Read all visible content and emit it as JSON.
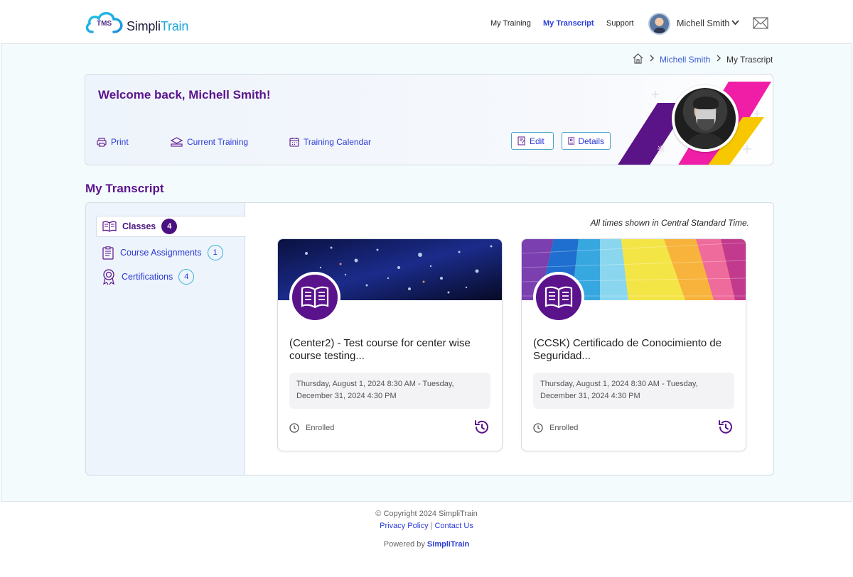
{
  "app": {
    "logo_badge": "TMS",
    "logo_name_part1": "Simpli",
    "logo_name_part2": "Train"
  },
  "nav": {
    "my_training": "My Training",
    "my_transcript": "My Transcript",
    "support": "Support",
    "user_name": "Michell Smith"
  },
  "breadcrumb": {
    "user": "Michell Smith",
    "current": "My Trascript"
  },
  "banner": {
    "welcome": "Welcome back, Michell Smith!",
    "print": "Print",
    "current_training": "Current Training",
    "training_calendar": "Training Calendar",
    "edit": "Edit",
    "details": "Details"
  },
  "section_title": "My Transcript",
  "sidebar": {
    "items": [
      {
        "label": "Classes",
        "count": "4",
        "active": true
      },
      {
        "label": "Course Assignments",
        "count": "1",
        "active": false
      },
      {
        "label": "Certifications",
        "count": "4",
        "active": false
      }
    ]
  },
  "timezone_note": "All times shown in Central Standard Time.",
  "cards": [
    {
      "title": "(Center2) - Test course for center wise course testing...",
      "dates": "Thursday, August 1, 2024 8:30 AM - Tuesday, December 31, 2024 4:30 PM",
      "status": "Enrolled"
    },
    {
      "title": "(CCSK) Certificado de Conocimiento de Seguridad...",
      "dates": "Thursday, August 1, 2024 8:30 AM - Tuesday, December 31, 2024 4:30 PM",
      "status": "Enrolled"
    }
  ],
  "footer": {
    "copyright": "© Copyright 2024  SimpliTrain",
    "privacy": "Privacy Policy",
    "contact": "Contact Us",
    "powered_prefix": "Powered by ",
    "powered_brand": "SimpliTrain"
  },
  "colors": {
    "brand_purple": "#5b138c",
    "link_blue": "#2b3ad6",
    "accent_cyan": "#3ab0d9"
  }
}
